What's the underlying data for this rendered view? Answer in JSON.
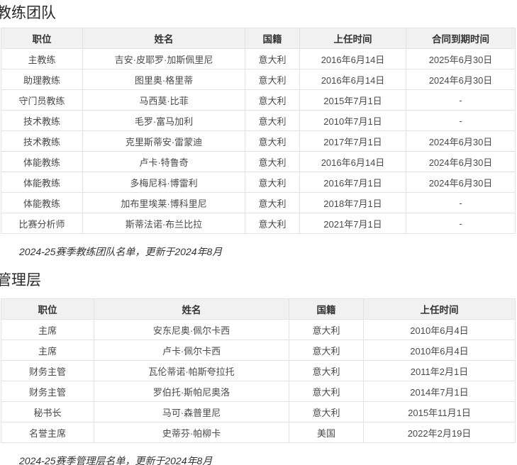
{
  "colors": {
    "header_bg": "#f1f1f1",
    "border": "#e2e2e2",
    "cell_text": "#4a4a4a",
    "title_text": "#2b2b2b"
  },
  "coaching": {
    "title": "教练团队",
    "table": {
      "headers": [
        "职位",
        "姓名",
        "国籍",
        "上任时间",
        "合同到期时间"
      ],
      "rows": [
        [
          "主教练",
          "吉安·皮耶罗·加斯佩里尼",
          "意大利",
          "2016年6月14日",
          "2025年6月30日"
        ],
        [
          "助理教练",
          "图里奥·格里蒂",
          "意大利",
          "2016年6月14日",
          "2024年6月30日"
        ],
        [
          "守门员教练",
          "马西莫·比菲",
          "意大利",
          "2015年7月1日",
          "-"
        ],
        [
          "技术教练",
          "毛罗·富马加利",
          "意大利",
          "2010年7月1日",
          "-"
        ],
        [
          "技术教练",
          "克里斯蒂安·雷蒙迪",
          "意大利",
          "2017年7月1日",
          "2024年6月30日"
        ],
        [
          "体能教练",
          "卢卡·特鲁奇",
          "意大利",
          "2016年6月14日",
          "2024年6月30日"
        ],
        [
          "体能教练",
          "多梅尼科·博雷利",
          "意大利",
          "2016年7月1日",
          "2024年6月30日"
        ],
        [
          "体能教练",
          "加布里埃莱·博科里尼",
          "意大利",
          "2018年7月1日",
          "-"
        ],
        [
          "比赛分析师",
          "斯蒂法诺·布兰比拉",
          "意大利",
          "2021年7月1日",
          "-"
        ]
      ]
    },
    "caption": "2024-25赛季教练团队名单，更新于2024年8月"
  },
  "management": {
    "title": "管理层",
    "table": {
      "headers": [
        "职位",
        "姓名",
        "国籍",
        "上任时间"
      ],
      "rows": [
        [
          "主席",
          "安东尼奥·佩尔卡西",
          "意大利",
          "2010年6月4日"
        ],
        [
          "主席",
          "卢卡·佩尔卡西",
          "意大利",
          "2010年6月4日"
        ],
        [
          "财务主管",
          "瓦伦蒂诺·帕斯夸拉托",
          "意大利",
          "2011年2月1日"
        ],
        [
          "财务主管",
          "罗伯托·斯帕尼奥洛",
          "意大利",
          "2014年7月1日"
        ],
        [
          "秘书长",
          "马可·森普里尼",
          "意大利",
          "2015年11月1日"
        ],
        [
          "名誉主席",
          "史蒂芬·帕柳卡",
          "美国",
          "2022年2月19日"
        ]
      ]
    },
    "caption": "2024-25赛季管理层名单，更新于2024年8月"
  }
}
